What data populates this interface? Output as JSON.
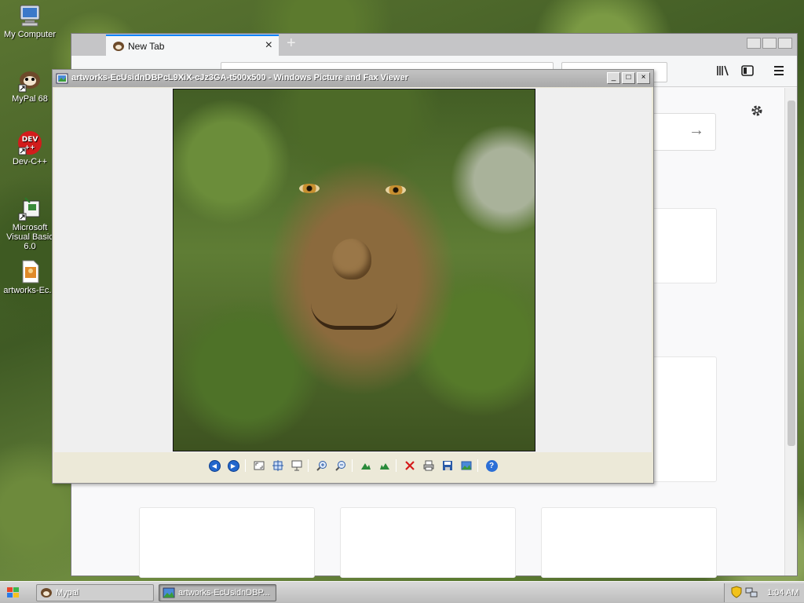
{
  "desktop": {
    "icons": [
      {
        "label": "My Computer",
        "icon": "computer-icon"
      },
      {
        "label": "MyPal 68",
        "icon": "mypal-icon"
      },
      {
        "label": "Dev-C++",
        "icon": "devcpp-icon"
      },
      {
        "label": "Microsoft Visual Basic 6.0",
        "icon": "visual-basic-icon"
      },
      {
        "label": "artworks-Ec...",
        "icon": "image-file-icon"
      }
    ],
    "devcpp_logo_text": "DEV"
  },
  "browser": {
    "tab_title": "New Tab",
    "tab_close": "×",
    "new_tab": "+",
    "go_arrow": "→",
    "accent": "#0a84ff",
    "icons": [
      "library-icon",
      "sidebar-icon",
      "menu-icon",
      "settings-gear-icon"
    ]
  },
  "viewer": {
    "title": "artworks-EcUsidnDBPcL9XiX-cJz3GA-t500x500 - Windows Picture and Fax Viewer",
    "buttons": {
      "minimize": "_",
      "maximize": "□",
      "close": "×"
    },
    "toolbar": [
      "previous-image",
      "next-image",
      "best-fit",
      "actual-size",
      "slideshow",
      "zoom-in",
      "zoom-out",
      "rotate-clockwise",
      "rotate-counterclockwise",
      "delete",
      "print",
      "save",
      "edit",
      "help"
    ]
  },
  "taskbar": {
    "tasks": [
      {
        "label": "Mypal",
        "active": false
      },
      {
        "label": "artworks-EcUsidnDBP...",
        "active": true
      }
    ],
    "clock": "1:04 AM"
  }
}
